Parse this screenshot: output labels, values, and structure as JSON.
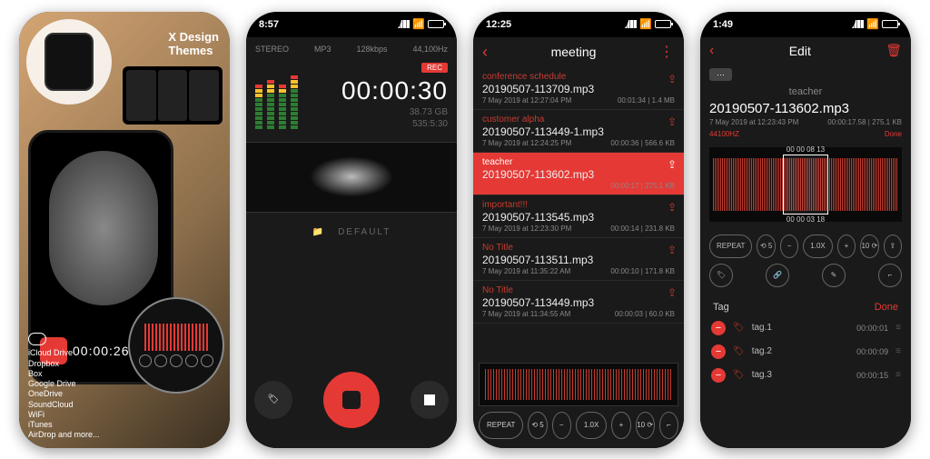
{
  "promo": {
    "title_l1": "X Design",
    "title_l2": "Themes",
    "rec_time": "00:00:26",
    "services": [
      "iCloud Drive",
      "Dropbox",
      "Box",
      "Google Drive",
      "OneDrive",
      "SoundCloud",
      "WiFi",
      "iTunes",
      "AirDrop and more..."
    ]
  },
  "recorder": {
    "status_time": "8:57",
    "info": {
      "channels": "STEREO",
      "format": "MP3",
      "bitrate": "128kbps",
      "sample": "44,100Hz"
    },
    "rec_badge": "REC",
    "timer": "00:00:30",
    "storage": "38.73 GB",
    "remaining": "535:5:30",
    "folder": "DEFAULT"
  },
  "list": {
    "status_time": "12:25",
    "title": "meeting",
    "items": [
      {
        "cat": "conference schedule",
        "file": "20190507-113709.mp3",
        "date": "7 May 2019 at 12:27:04 PM",
        "dur": "00:01:34",
        "size": "1.4 MB"
      },
      {
        "cat": "customer alpha",
        "file": "20190507-113449-1.mp3",
        "date": "7 May 2019 at 12:24:25 PM",
        "dur": "00:00:36",
        "size": "566.6 KB"
      },
      {
        "cat": "teacher",
        "file": "20190507-113602.mp3",
        "date": "",
        "dur": "00:00:17",
        "size": "275.1 KB",
        "sel": true
      },
      {
        "cat": "important!!!",
        "file": "20190507-113545.mp3",
        "date": "7 May 2019 at 12:23:30 PM",
        "dur": "00:00:14",
        "size": "231.8 KB"
      },
      {
        "cat": "No Title",
        "file": "20190507-113511.mp3",
        "date": "7 May 2019 at 11:35:22 AM",
        "dur": "00:00:10",
        "size": "171.8 KB"
      },
      {
        "cat": "No Title",
        "file": "20190507-113449.mp3",
        "date": "7 May 2019 at 11:34:55 AM",
        "dur": "00:00:03",
        "size": "60.0 KB"
      }
    ],
    "player": {
      "repeat": "REPEAT",
      "skip_back": "⟲ 5",
      "minus": "−",
      "speed": "1.0X",
      "plus": "+",
      "skip_fwd": "10 ⟳",
      "crop": "⌐"
    }
  },
  "edit": {
    "status_time": "1:49",
    "title": "Edit",
    "chip": "···",
    "category": "teacher",
    "file": "20190507-113602.mp3",
    "date": "7 May 2019 at 12:23:43 PM",
    "dur_size": "00:00:17.58 | 275.1 KB",
    "format": "44100HZ",
    "done_label": "Done",
    "sel_start": "00 00 08 13",
    "sel_end": "00 00 03 18",
    "ctl1": {
      "repeat": "REPEAT",
      "sb": "⟲ 5",
      "m": "−",
      "spd": "1.0X",
      "p": "+",
      "sf": "10 ⟳",
      "share": "⇪"
    },
    "ctl2": {
      "tag": "🏷",
      "link": "🔗",
      "sig": "✎",
      "crop": "⌐"
    },
    "tag_header": "Tag",
    "tag_done": "Done",
    "tags": [
      {
        "name": "tag.1",
        "time": "00:00:01"
      },
      {
        "name": "tag.2",
        "time": "00:00:09"
      },
      {
        "name": "tag.3",
        "time": "00:00:15"
      }
    ]
  }
}
